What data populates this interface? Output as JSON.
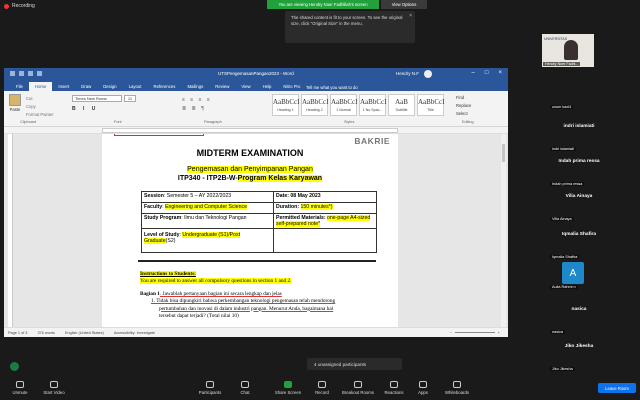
{
  "zoom": {
    "recording": "Recording",
    "viewing_banner": "You are viewing Hendry Noer Fadhlilah's screen",
    "view_options": "View Options",
    "tooltip": "The shared content is fit to your screen. To see the original size, click \"Original Size\" in the menu.",
    "unassigned": "4 unassigned participants",
    "leave": "Leave Room",
    "toolbar": [
      {
        "label": "Unmute"
      },
      {
        "label": "Start Video"
      },
      {
        "label": "Participants"
      },
      {
        "label": "Chat"
      },
      {
        "label": "Share Screen"
      },
      {
        "label": "Record"
      },
      {
        "label": "Breakout Rooms"
      },
      {
        "label": "Reactions"
      },
      {
        "label": "Apps"
      },
      {
        "label": "Whiteboards"
      }
    ],
    "participant_badges": [
      "2",
      "17"
    ],
    "participants": [
      {
        "video_name": "Hendry Noer Fadhl...",
        "logo": "UNIVERSITAS"
      },
      {
        "name": "",
        "sub": "zoom kaxl4"
      },
      {
        "name": "indri islamiati",
        "sub": "indri islamiati"
      },
      {
        "name": "Indah prima ressa",
        "sub": "Indah prima ressa"
      },
      {
        "name": "Vilia Ainaya",
        "sub": "Vilia Ainaya"
      },
      {
        "name": "Iqmalia Shafira",
        "sub": "Iqmalia Shafira"
      },
      {
        "name": "",
        "sub": "Aulia Rahmi n",
        "avatar": "A"
      },
      {
        "name": "nasica",
        "sub": "nasica"
      },
      {
        "name": "Jiko Jikesha",
        "sub": "Jiko Jikesha"
      }
    ]
  },
  "word": {
    "title": "UTSPengemasanPangan2023  -  Word",
    "user": "Hendry N.F",
    "tabs": [
      "File",
      "Home",
      "Insert",
      "Draw",
      "Design",
      "Layout",
      "References",
      "Mailings",
      "Review",
      "View",
      "Help",
      "Nitro Pro"
    ],
    "tell_me": "Tell me what you want to do",
    "font_name": "Times New Roma",
    "font_size": "11",
    "clipboard": {
      "paste": "Paste",
      "cut": "Cut",
      "copy": "Copy",
      "format_painter": "Format Painter",
      "group": "Clipboard"
    },
    "groups": {
      "font": "Font",
      "paragraph": "Paragraph",
      "styles": "Styles",
      "editing": "Editing"
    },
    "styles": [
      {
        "sample": "AaBbCcI",
        "name": "Heading 1"
      },
      {
        "sample": "AaBbCcI",
        "name": "Heading 2"
      },
      {
        "sample": "AaBbCcI",
        "name": "1 Normal"
      },
      {
        "sample": "AaBbCcI",
        "name": "1 No Spac..."
      },
      {
        "sample": "AaB",
        "name": "Subtitle"
      },
      {
        "sample": "AaBbCcI",
        "name": "Title"
      }
    ],
    "editing_items": [
      "Find",
      "Replace",
      "Select"
    ],
    "status": {
      "page": "Page 1 of 3",
      "words": "376 words",
      "language": "English (United States)",
      "accessibility": "Accessibility: Investigate"
    }
  },
  "document": {
    "logo": "BAKRIE",
    "heading": "MIDTERM EXAMINATION",
    "course": "Pengemasan dan Penyimpanan Pangan",
    "course_code": "ITP340 - ITP2B-W-",
    "program": "Program Kelas Karyawan",
    "info": {
      "session_label": "Session",
      "session_value": ": Semester 5 – AY 2022/2023",
      "date": "Date: 08 May 2023",
      "faculty_label": "Faculty",
      "faculty_value": "Engineering and Computer Science",
      "duration_label": "Duration: ",
      "duration_value": "150 minutes*)",
      "program_label": "Study Program",
      "program_value": ": Ilmu dan Teknologi Pangan",
      "materials_label": "Permitted Materials: ",
      "materials_value": "one-page A4-sized self-prepared note*",
      "level_label": "Level of Study",
      "level_value": "Undergraduate (S1)/Post Graduate",
      "level_suffix": "(S2)"
    },
    "instructions_title": "Instructions to Students:",
    "instructions_text": "You are required to answer all compulsory questions in section 1 and 2.",
    "section_title": "Bagian 1",
    "section_text": ". Jawablah pertanyaan bagian ini secara lengkap dan jelas",
    "q1_line1": "1.   Tidak bisa dipungkiri bahwa perkembangan teknologi pengemasan telah mendorong",
    "q1_line2": "pertumbuhan dan inovasi di dalam industri pangan.  Menurut Anda, bagaimana hal",
    "q1_line3": "tersebut dapat terjadi? (Total nilai 10)"
  }
}
